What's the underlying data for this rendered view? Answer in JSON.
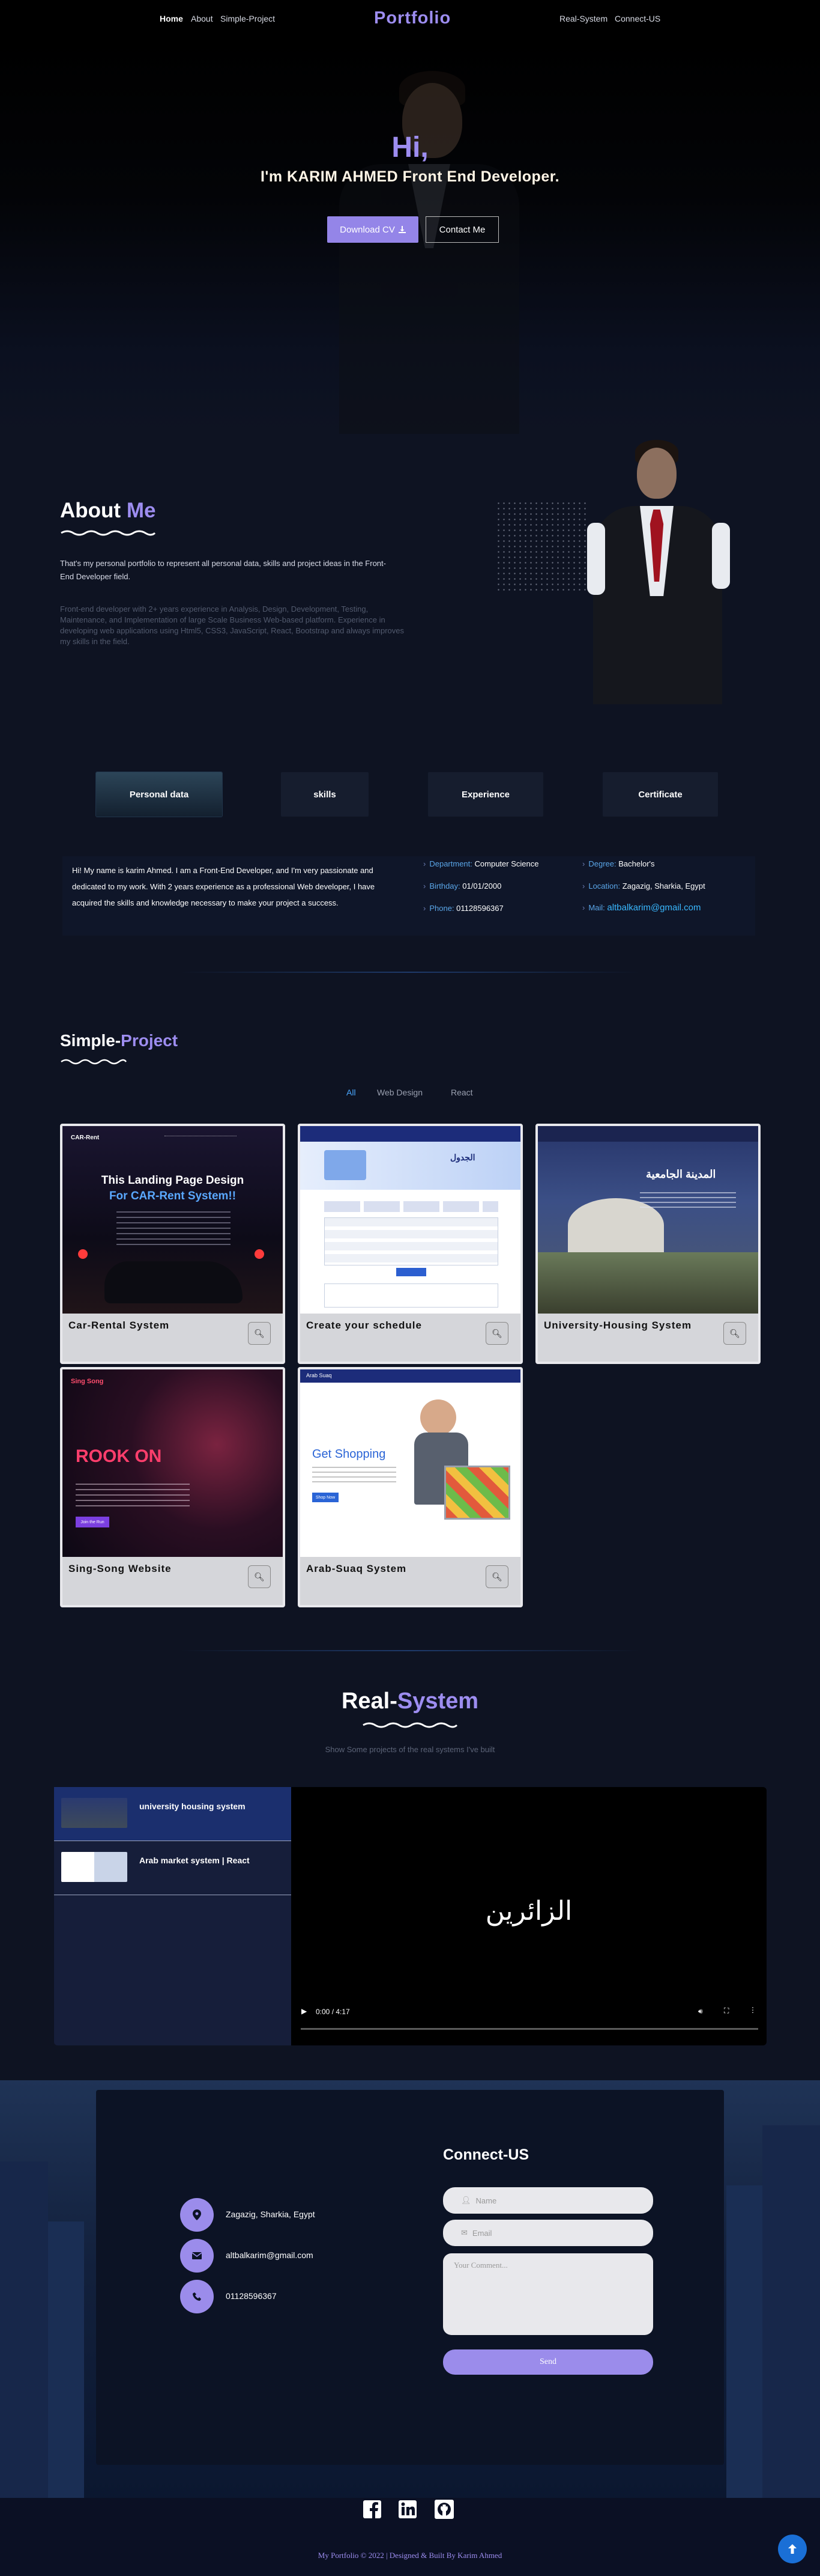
{
  "nav": {
    "links_left": [
      "Home",
      "About",
      "Simple-Project"
    ],
    "brand": "Portfolio",
    "links_right": [
      "Real-System",
      "Connect-US"
    ]
  },
  "hero": {
    "title": "Hi,",
    "subtitle": "I'm KARIM AHMED Front End Developer.",
    "download_label": "Download CV",
    "contact_label": "Contact Me"
  },
  "about": {
    "heading_plain": "About",
    "heading_accent": "Me",
    "intro": "That's my personal portfolio to represent all personal data, skills and project ideas in the Front-End Developer field.",
    "body": "Front-end developer with 2+ years experience in Analysis, Design, Development, Testing, Maintenance, and Implementation of large Scale Business Web-based platform. Experience in developing web applications using Html5, CSS3, JavaScript, React, Bootstrap and always improves my skills in the field."
  },
  "tabs": [
    "Personal data",
    "skills",
    "Experience",
    "Certificate"
  ],
  "personal": {
    "text": "Hi! My name is karim Ahmed. I am a Front-End Developer, and I'm very passionate and dedicated to my work. With 2 years experience as a professional Web developer, I have acquired the skills and knowledge necessary to make your project a success.",
    "details": [
      {
        "label": "Department:",
        "value": "Computer Science"
      },
      {
        "label": "Degree:",
        "value": "Bachelor's"
      },
      {
        "label": "Birthday:",
        "value": "01/01/2000"
      },
      {
        "label": "Location:",
        "value": "Zagazig, Sharkia, Egypt"
      },
      {
        "label": "Phone:",
        "value": "01128596367"
      },
      {
        "label": "Mail:",
        "value": "altbalkarim@gmail.com"
      }
    ]
  },
  "projects": {
    "heading_plain": "Simple-",
    "heading_accent": "Project",
    "filters": [
      "All",
      "Web Design",
      "React"
    ],
    "items": [
      {
        "title": "Car-Rental System",
        "shot": {
          "h1": "This Landing Page Design",
          "h2": "For CAR-Rent System!!",
          "logo": "CAR-Rent"
        }
      },
      {
        "title": "Create your schedule",
        "shot": {
          "logo": "الجدول"
        }
      },
      {
        "title": "University-Housing System",
        "shot": {
          "h1": "المدينة الجامعية"
        }
      },
      {
        "title": "Sing-Song Website",
        "shot": {
          "logo": "Sing Song",
          "h1": "ROOK ON",
          "btn": "Join the Run"
        }
      },
      {
        "title": "Arab-Suaq System",
        "shot": {
          "logo": "Arab Suaq",
          "h1": "Get Shopping",
          "btn": "Shop Now"
        }
      }
    ]
  },
  "real": {
    "heading_plain": "Real-",
    "heading_accent": "System",
    "subtitle": "Show Some projects of the real systems I've built",
    "items": [
      "university housing system",
      "Arab market system | React"
    ],
    "video_text": "الزائرين",
    "video_time": "0:00 / 4:17"
  },
  "contact": {
    "heading": "Connect-US",
    "address": "Zagazig, Sharkia, Egypt",
    "email": "altbalkarim@gmail.com",
    "phone": "01128596367",
    "name_placeholder": "Name",
    "email_placeholder": "Email",
    "comment_placeholder": "Your Comment...",
    "send_label": "Send"
  },
  "footer": {
    "copyright": "My Portfolio © 2022 | Designed & Built By Karim Ahmed"
  },
  "colors": {
    "accent": "#9d8df0",
    "link": "#4aa8ff",
    "bg": "#0e1322"
  }
}
